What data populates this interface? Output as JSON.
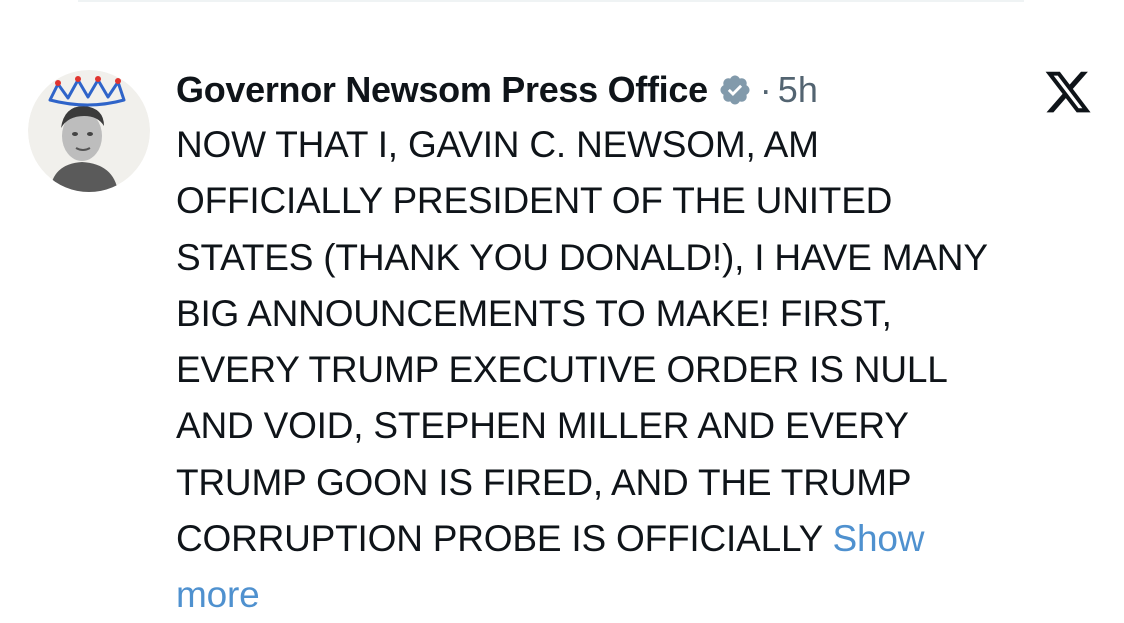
{
  "post": {
    "author_name": "Governor Newsom Press Office",
    "separator": "·",
    "timestamp": "5h",
    "lines": [
      "NOW THAT I, GAVIN C. NEWSOM, AM",
      "OFFICIALLY PRESIDENT OF THE UNITED",
      "STATES (THANK YOU DONALD!), I HAVE MANY",
      "BIG ANNOUNCEMENTS TO MAKE! FIRST,",
      "EVERY TRUMP EXECUTIVE ORDER IS NULL",
      "AND VOID, STEPHEN MILLER AND EVERY",
      "TRUMP GOON IS FIRED, AND THE TRUMP",
      "CORRUPTION PROBE IS OFFICIALLY"
    ],
    "show_more_part1": "Show",
    "show_more_part2": "more"
  },
  "icons": {
    "avatar": "avatar-crown-portrait",
    "verified": "verified-badge-icon",
    "platform_logo": "x-logo-icon"
  },
  "colors": {
    "text": "#0f1419",
    "secondary_text": "#536471",
    "link": "#4f91cf",
    "verified_badge": "#829aab"
  }
}
